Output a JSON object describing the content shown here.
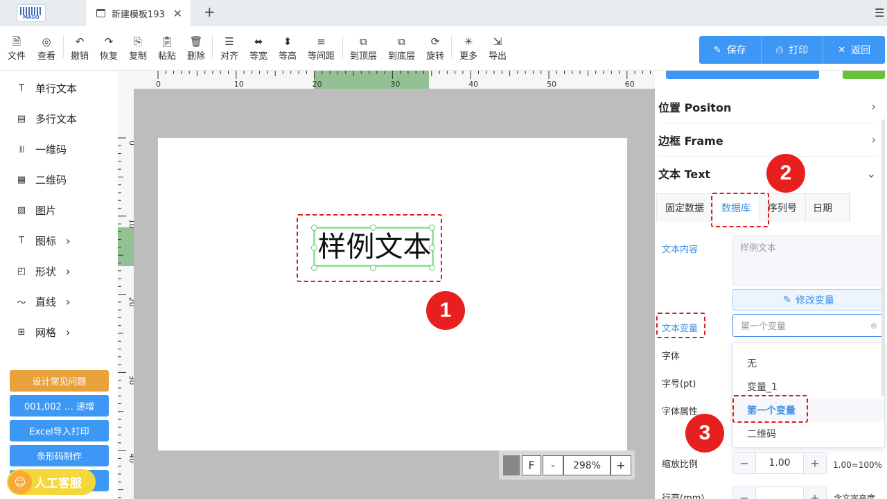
{
  "tabbar": {
    "logo_text": "MASO",
    "tab_title": "新建模板193",
    "close": "✕",
    "new_tab": "+",
    "menu": "☰"
  },
  "toolbar": {
    "items": [
      {
        "label": "文件",
        "icon": "file-icon"
      },
      {
        "label": "查看",
        "icon": "eye-icon"
      },
      {
        "label": "撤销",
        "icon": "undo-icon"
      },
      {
        "label": "恢复",
        "icon": "redo-icon"
      },
      {
        "label": "复制",
        "icon": "copy-icon"
      },
      {
        "label": "粘贴",
        "icon": "paste-icon"
      },
      {
        "label": "删除",
        "icon": "trash-icon"
      },
      {
        "label": "对齐",
        "icon": "align-icon"
      },
      {
        "label": "等宽",
        "icon": "equal-width-icon"
      },
      {
        "label": "等高",
        "icon": "equal-height-icon"
      },
      {
        "label": "等间距",
        "icon": "spacing-icon"
      },
      {
        "label": "到顶层",
        "icon": "bring-front-icon"
      },
      {
        "label": "到底层",
        "icon": "send-back-icon"
      },
      {
        "label": "旋转",
        "icon": "rotate-icon"
      },
      {
        "label": "更多",
        "icon": "more-icon"
      },
      {
        "label": "导出",
        "icon": "export-icon"
      }
    ],
    "save": "保存",
    "print": "打印",
    "back": "返回"
  },
  "sidebar": {
    "items": [
      {
        "label": "单行文本",
        "icon": "T"
      },
      {
        "label": "多行文本",
        "icon": "▤"
      },
      {
        "label": "一维码",
        "icon": "|||"
      },
      {
        "label": "二维码",
        "icon": "▦"
      },
      {
        "label": "图片",
        "icon": "▨"
      },
      {
        "label": "图标",
        "icon": "T"
      },
      {
        "label": "形状",
        "icon": "◰"
      },
      {
        "label": "直线",
        "icon": "〜"
      },
      {
        "label": "网格",
        "icon": "⊞"
      }
    ],
    "buttons": [
      {
        "label": "设计常见问题",
        "color": "#e9a23b"
      },
      {
        "label": "001,002 … 递增",
        "color": "#3d97f5"
      },
      {
        "label": "Excel导入打印",
        "color": "#3d97f5"
      },
      {
        "label": "条形码制作",
        "color": "#3d97f5"
      },
      {
        "label": "",
        "color": "#3d97f5"
      }
    ],
    "support": "人工客服"
  },
  "ruler": {
    "h_labels": [
      "0",
      "10",
      "20",
      "30",
      "40",
      "50",
      "60"
    ],
    "v_labels": [
      "0",
      "10",
      "20",
      "30",
      "40"
    ]
  },
  "canvas": {
    "sample_text": "样例文本",
    "zoom": "298%",
    "f": "F",
    "minus": "-",
    "plus": "+"
  },
  "badges": [
    "1",
    "2",
    "3"
  ],
  "panel": {
    "sections": [
      {
        "label": "位置 Positon",
        "chev": "›"
      },
      {
        "label": "边框 Frame",
        "chev": "›"
      },
      {
        "label": "文本 Text",
        "chev": "⌄"
      }
    ],
    "tabs": [
      "固定数据",
      "数据库",
      "序列号",
      "日期"
    ],
    "content_label": "文本内容",
    "content_value": "样例文本",
    "modify_var": "修改变量",
    "var_label": "文本变量",
    "var_placeholder": "第一个变量",
    "font_label": "字体",
    "size_label": "字号(pt)",
    "attr_label": "字体属性",
    "options": [
      "无",
      "变量_1",
      "第一个变量",
      "二维码"
    ],
    "scale_label": "缩放比例",
    "scale_value": "1.00",
    "scale_hint": "1.00=100%",
    "line_label": "行高(mm)",
    "line_hint": "含文字高度"
  },
  "colors": {
    "accent": "#3d97f5",
    "danger": "#e81f1f"
  }
}
